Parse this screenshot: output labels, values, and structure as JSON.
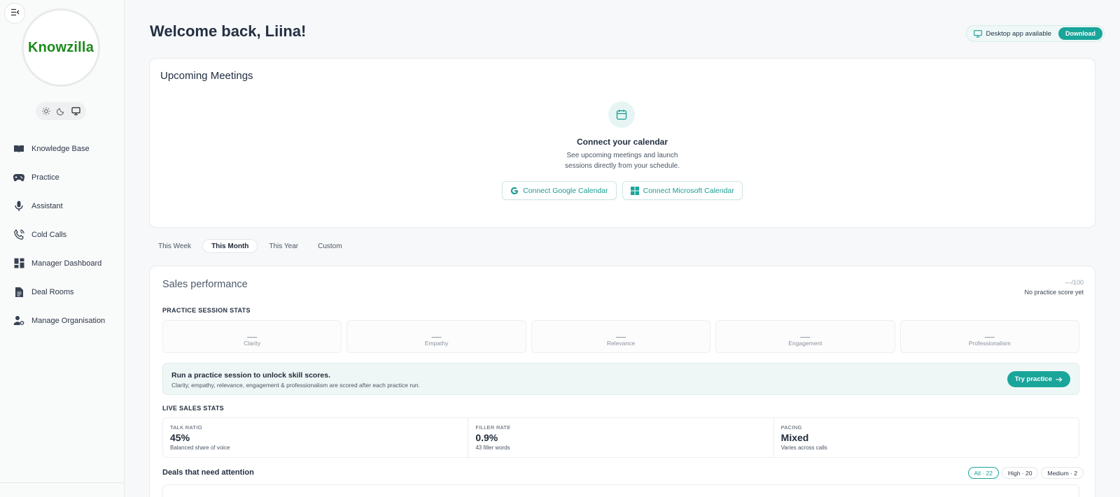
{
  "app": {
    "logo_text": "Knowzilla",
    "brand_green": "#1b8a1b",
    "accent": "#1aa59a"
  },
  "sidebar": {
    "collapse_icon": "sidebar-collapse-icon",
    "theme": {
      "options": [
        "sun-icon",
        "moon-icon",
        "monitor-icon"
      ],
      "selected": "monitor-icon"
    },
    "items": [
      {
        "label": "Knowledge Base",
        "icon": "book-open-icon"
      },
      {
        "label": "Practice",
        "icon": "gamepad-icon"
      },
      {
        "label": "Assistant",
        "icon": "microphone-icon"
      },
      {
        "label": "Cold Calls",
        "icon": "phone-call-icon"
      },
      {
        "label": "Manager Dashboard",
        "icon": "dashboard-icon"
      },
      {
        "label": "Deal Rooms",
        "icon": "document-icon"
      },
      {
        "label": "Manage Organisation",
        "icon": "users-cog-icon"
      }
    ]
  },
  "header": {
    "welcome": "Welcome back, Liina!",
    "desktop_text": "Desktop app available",
    "download_label": "Download"
  },
  "meetings": {
    "title": "Upcoming Meetings",
    "connect_title": "Connect your calendar",
    "connect_desc_1": "See upcoming meetings and launch",
    "connect_desc_2": "sessions directly from your schedule.",
    "google_btn": "Connect Google Calendar",
    "microsoft_btn": "Connect Microsoft Calendar"
  },
  "period_tabs": {
    "items": [
      "This Week",
      "This Month",
      "This Year",
      "Custom"
    ],
    "selected": "This Month"
  },
  "performance": {
    "title": "Sales performance",
    "score_value": "—/100",
    "score_sub": "No practice score yet",
    "practice_label": "PRACTICE SESSION STATS",
    "skills": [
      {
        "value": "—",
        "label": "Clarity"
      },
      {
        "value": "—",
        "label": "Empathy"
      },
      {
        "value": "—",
        "label": "Relevance"
      },
      {
        "value": "—",
        "label": "Engagement"
      },
      {
        "value": "—",
        "label": "Professionalism"
      }
    ],
    "unlock_title": "Run a practice session to unlock skill scores.",
    "unlock_desc": "Clarity, empathy, relevance, engagement & professionalism are scored after each practice run.",
    "try_label": "Try practice",
    "live_label": "LIVE SALES STATS",
    "live": [
      {
        "head": "TALK RATIO",
        "value": "45%",
        "sub": "Balanced share of voice"
      },
      {
        "head": "FILLER RATE",
        "value": "0.9%",
        "sub": "43 filler words"
      },
      {
        "head": "PACING",
        "value": "Mixed",
        "sub": "Varies across calls"
      }
    ],
    "deals_title": "Deals that need attention",
    "deal_filters": [
      "All · 22",
      "High · 20",
      "Medium · 2"
    ],
    "deal_filter_selected": "All · 22"
  }
}
